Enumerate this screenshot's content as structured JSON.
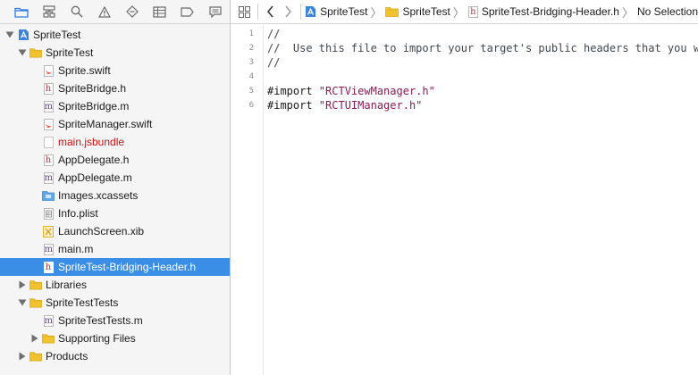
{
  "navigator_bar": {
    "buttons": [
      "project-navigator",
      "source-control-navigator",
      "symbol-navigator",
      "find-navigator",
      "issue-navigator",
      "test-navigator",
      "debug-navigator",
      "breakpoint-navigator",
      "report-navigator"
    ]
  },
  "tree": [
    {
      "label": "SpriteTest",
      "icon": "xcode-project-icon",
      "level": 0,
      "disclosure": "open"
    },
    {
      "label": "SpriteTest",
      "icon": "folder-icon",
      "level": 1,
      "disclosure": "open"
    },
    {
      "label": "Sprite.swift",
      "icon": "swift-file-icon",
      "level": 2
    },
    {
      "label": "SpriteBridge.h",
      "icon": "header-file-icon",
      "level": 2
    },
    {
      "label": "SpriteBridge.m",
      "icon": "objc-file-icon",
      "level": 2
    },
    {
      "label": "SpriteManager.swift",
      "icon": "swift-file-icon",
      "level": 2
    },
    {
      "label": "main.jsbundle",
      "icon": "blank-file-icon",
      "level": 2,
      "missing": true
    },
    {
      "label": "AppDelegate.h",
      "icon": "header-file-icon",
      "level": 2
    },
    {
      "label": "AppDelegate.m",
      "icon": "objc-file-icon",
      "level": 2
    },
    {
      "label": "Images.xcassets",
      "icon": "asset-catalog-icon",
      "level": 2
    },
    {
      "label": "Info.plist",
      "icon": "plist-file-icon",
      "level": 2
    },
    {
      "label": "LaunchScreen.xib",
      "icon": "xib-file-icon",
      "level": 2
    },
    {
      "label": "main.m",
      "icon": "objc-file-icon",
      "level": 2
    },
    {
      "label": "SpriteTest-Bridging-Header.h",
      "icon": "header-file-icon",
      "level": 2,
      "selected": true
    },
    {
      "label": "Libraries",
      "icon": "folder-icon",
      "level": 1,
      "disclosure": "closed"
    },
    {
      "label": "SpriteTestTests",
      "icon": "folder-icon",
      "level": 1,
      "disclosure": "open"
    },
    {
      "label": "SpriteTestTests.m",
      "icon": "objc-file-icon",
      "level": 2
    },
    {
      "label": "Supporting Files",
      "icon": "folder-icon",
      "level": 2,
      "disclosure": "closed"
    },
    {
      "label": "Products",
      "icon": "folder-icon",
      "level": 1,
      "disclosure": "closed"
    }
  ],
  "jumpbar": {
    "crumbs": [
      {
        "label": "SpriteTest",
        "icon": "xcode-project-icon"
      },
      {
        "label": "SpriteTest",
        "icon": "folder-icon"
      },
      {
        "label": "SpriteTest-Bridging-Header.h",
        "icon": "header-file-icon"
      },
      {
        "label": "No Selection",
        "icon": ""
      }
    ]
  },
  "editor": {
    "lines": [
      {
        "num": "1",
        "parts": [
          {
            "cls": "cmt",
            "text": "//"
          }
        ]
      },
      {
        "num": "2",
        "parts": [
          {
            "cls": "cmt",
            "text": "//  Use this file to import your target's public headers that you would like to expose to Swift."
          }
        ]
      },
      {
        "num": "3",
        "parts": [
          {
            "cls": "cmt",
            "text": "//"
          }
        ]
      },
      {
        "num": "4",
        "parts": []
      },
      {
        "num": "5",
        "parts": [
          {
            "cls": "kw",
            "text": "#import "
          },
          {
            "cls": "str",
            "text": "\"RCTViewManager.h\""
          }
        ]
      },
      {
        "num": "6",
        "parts": [
          {
            "cls": "kw",
            "text": "#import "
          },
          {
            "cls": "str",
            "text": "\"RCTUIManager.h\""
          }
        ]
      }
    ]
  },
  "colors": {
    "selection": "#3a8ee6",
    "folder": "#f2c230",
    "missing_file": "#d01010",
    "string_literal": "#8b1a53"
  }
}
